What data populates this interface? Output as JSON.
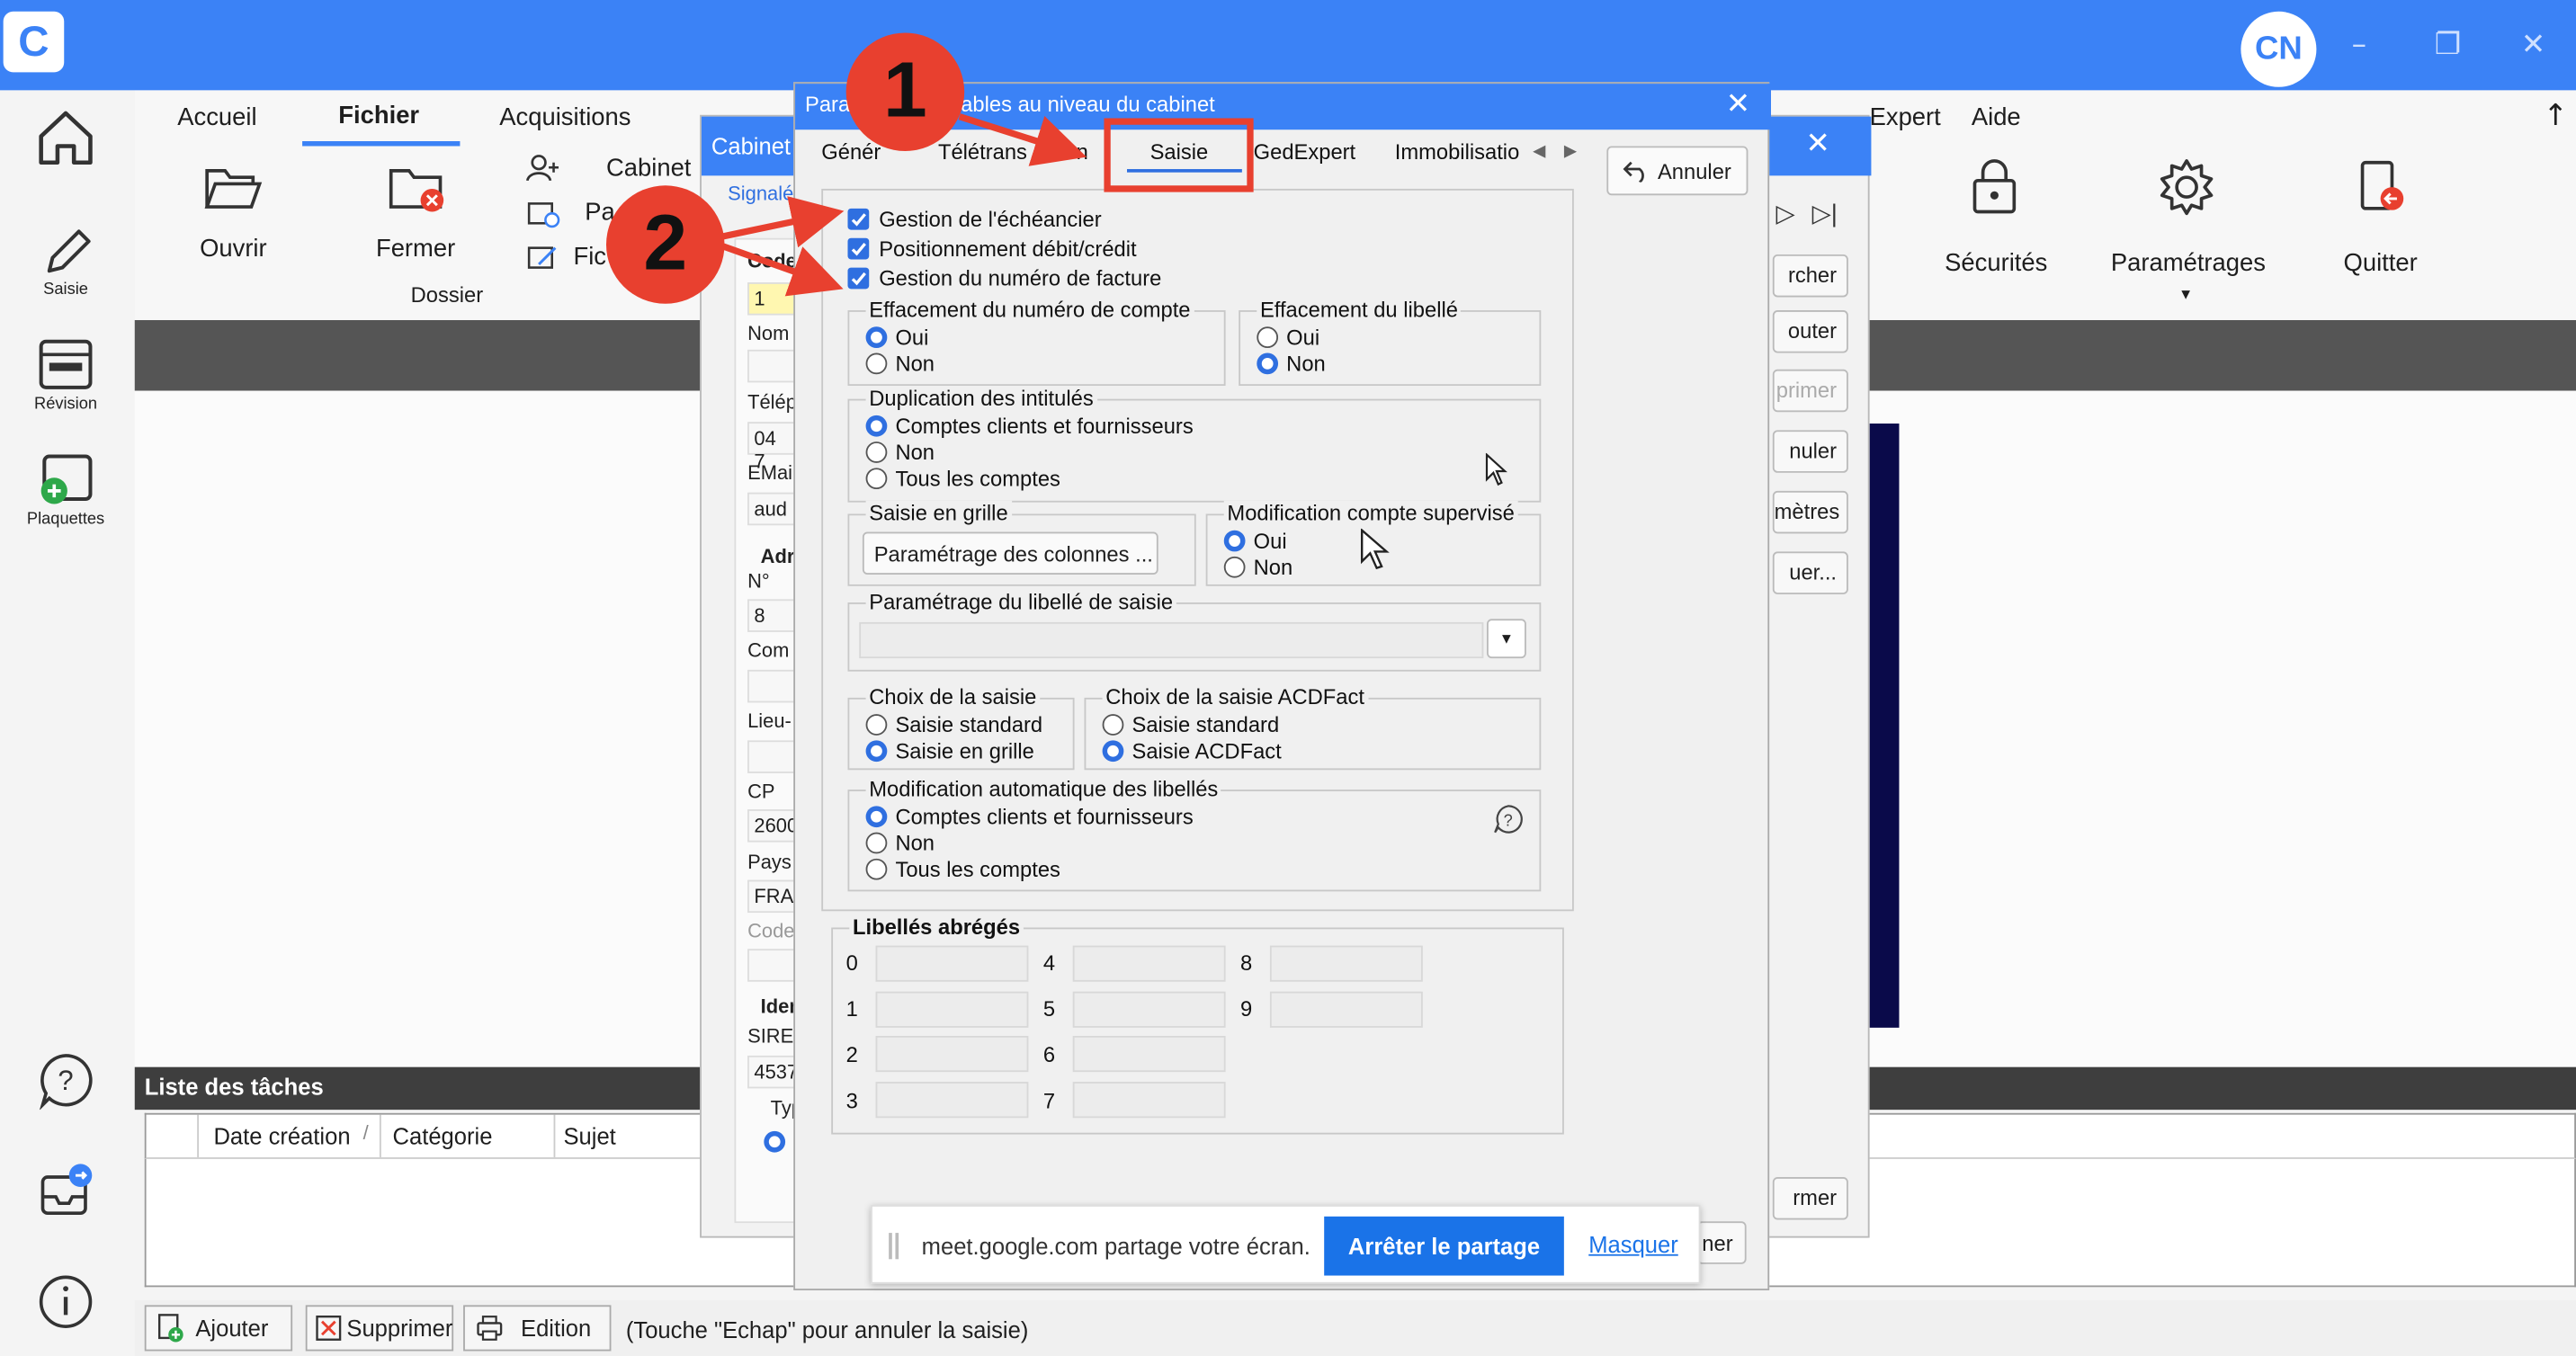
{
  "app": {
    "logo_letter": "C",
    "avatar_initials": "CN",
    "accent": "#3b82f6",
    "annotation_color": "#e8402f"
  },
  "rail": {
    "items": [
      {
        "label": "",
        "icon": "home-icon"
      },
      {
        "label": "Saisie",
        "icon": "pencil-icon"
      },
      {
        "label": "Révision",
        "icon": "revision-icon"
      },
      {
        "label": "Plaquettes",
        "icon": "plaquettes-icon"
      }
    ],
    "bottom_icons": [
      "help-icon",
      "inbox-icon",
      "info-icon"
    ]
  },
  "ribbon": {
    "tabs": [
      "Accueil",
      "Fichier",
      "Acquisitions",
      "Aide"
    ],
    "active_tab": "Fichier",
    "expert_tab_fragment": "Expert",
    "ouvrir": "Ouvrir",
    "fermer": "Fermer",
    "dossier_group": "Dossier",
    "cabinet": "Cabinet",
    "pa_fragment": "Pa",
    "fic_fragment": "Fic",
    "securites": "Sécurités",
    "parametrages": "Paramétrages",
    "quitter": "Quitter"
  },
  "tasks": {
    "title": "Liste des tâches",
    "columns": [
      "Date création",
      "Catégorie",
      "Sujet"
    ]
  },
  "statusbar": {
    "ajouter": "Ajouter",
    "supprimer": "Supprimer",
    "edition": "Edition",
    "hint": "(Touche \"Echap\" pour annuler la saisie)"
  },
  "cabinet_window": {
    "title": "Cabinet",
    "signal_fragment": "Signalé",
    "labels": [
      "Code",
      "Nom",
      "Télép",
      "EMai",
      "Adr",
      "N°",
      "Com",
      "Lieu-",
      "CP",
      "Pays",
      "Code",
      "Iden",
      "SIREN",
      "Typ"
    ],
    "values": {
      "code": "1",
      "tel": "04 7",
      "email": "aud",
      "numero": "8",
      "cp": "2600",
      "pays": "FRA",
      "siren": "4537"
    },
    "right_buttons": [
      "rcher",
      "outer",
      "primer",
      "nuler",
      "mètres",
      "uer..."
    ],
    "bottom_right_button": "rmer",
    "behind_button": "ner"
  },
  "dialog": {
    "title": "Paramètres comptables au niveau du cabinet",
    "title_visible_start": "Para",
    "title_visible_end": "ptables au niveau du cabinet",
    "tabs": [
      "Général",
      "Télétransmission",
      "Saisie",
      "GedExpert",
      "Immobilisatio"
    ],
    "tabs_visible": [
      "Génér",
      "Télétrans",
      "ssion",
      "Saisie",
      "GedExpert",
      "Immobilisatio"
    ],
    "active_tab": "Saisie",
    "annuler": "Annuler",
    "checkboxes": [
      {
        "label": "Gestion de l'échéancier",
        "checked": true
      },
      {
        "label": "Positionnement débit/crédit",
        "checked": true
      },
      {
        "label": "Gestion du numéro de facture",
        "checked": true
      }
    ],
    "groups": {
      "eff_compte": {
        "title": "Effacement du numéro de compte",
        "options": [
          "Oui",
          "Non"
        ],
        "selected": "Oui"
      },
      "eff_libelle": {
        "title": "Effacement du libellé",
        "options": [
          "Oui",
          "Non"
        ],
        "selected": "Non"
      },
      "duplication": {
        "title": "Duplication des intitulés",
        "options": [
          "Comptes clients et fournisseurs",
          "Non",
          "Tous les comptes"
        ],
        "selected": "Comptes clients et fournisseurs"
      },
      "saisie_grille": {
        "title": "Saisie en grille",
        "button": "Paramétrage des colonnes ..."
      },
      "modif_supervise": {
        "title": "Modification compte supervisé",
        "options": [
          "Oui",
          "Non"
        ],
        "selected": "Oui"
      },
      "param_libelle": {
        "title": "Paramétrage du libellé de saisie",
        "value": ""
      },
      "choix_saisie": {
        "title": "Choix de la saisie",
        "options": [
          "Saisie standard",
          "Saisie en grille"
        ],
        "selected": "Saisie en grille"
      },
      "choix_acdfact": {
        "title": "Choix de la saisie ACDFact",
        "options": [
          "Saisie standard",
          "Saisie ACDFact"
        ],
        "selected": "Saisie ACDFact"
      },
      "modif_auto": {
        "title": "Modification automatique des libellés",
        "options": [
          "Comptes clients et fournisseurs",
          "Non",
          "Tous les comptes"
        ],
        "selected": "Comptes clients et fournisseurs"
      }
    },
    "libelles_abreges": {
      "title": "Libellés abrégés",
      "indices": [
        "0",
        "1",
        "2",
        "3",
        "4",
        "5",
        "6",
        "7",
        "8",
        "9"
      ]
    }
  },
  "annotations": {
    "badge_1": "1",
    "badge_2": "2"
  },
  "share_bar": {
    "text": "meet.google.com partage votre écran.",
    "stop": "Arrêter le partage",
    "hide": "Masquer"
  }
}
